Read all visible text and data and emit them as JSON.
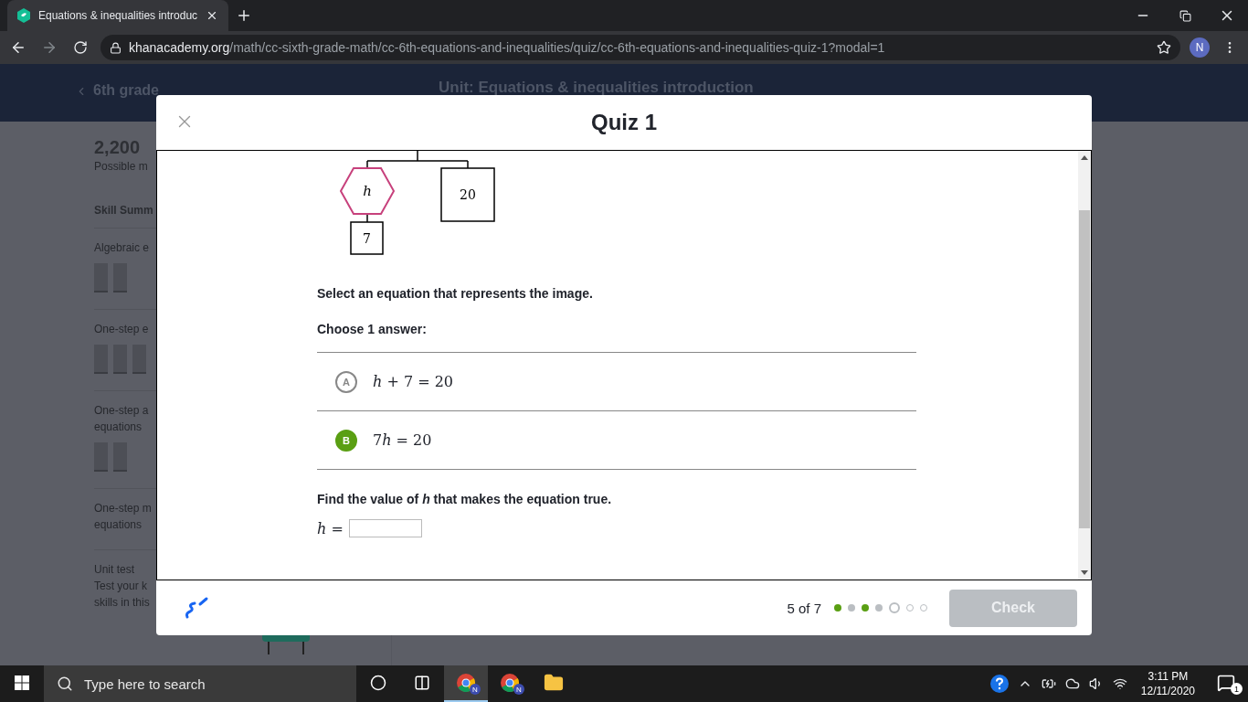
{
  "browser": {
    "tab": {
      "title": "Equations & inequalities introduc"
    },
    "url": {
      "domain": "khanacademy.org",
      "path": "/math/cc-sixth-grade-math/cc-6th-equations-and-inequalities/quiz/cc-6th-equations-and-inequalities-quiz-1?modal=1"
    },
    "profile_initial": "N"
  },
  "background_page": {
    "back_link": "6th grade",
    "unit_title": "Unit: Equations & inequalities introduction",
    "points": "2,200",
    "points_label": "Possible m",
    "section_title": "Skill Summ",
    "skills": [
      {
        "lines": [
          "Algebraic e"
        ],
        "bars": [
          {
            "mastered": false
          },
          {
            "mastered": false
          }
        ]
      },
      {
        "lines": [
          "One-step e"
        ],
        "bars": [
          {
            "mastered": false
          },
          {
            "mastered": false
          },
          {
            "mastered": false
          }
        ]
      },
      {
        "lines": [
          "One-step a",
          "equations"
        ],
        "bars": [
          {
            "mastered": false
          },
          {
            "mastered": false
          }
        ]
      },
      {
        "lines": [
          "One-step m",
          "equations"
        ]
      }
    ],
    "unit_test": {
      "title": "Unit test",
      "lines": [
        "Test your k",
        "skills in this"
      ]
    }
  },
  "modal": {
    "title": "Quiz 1",
    "diagram": {
      "top_node": "h",
      "side_node": "20",
      "bottom_node": "7"
    },
    "prompt": "Select an equation that represents the image.",
    "choose_label": "Choose 1 answer:",
    "choices": [
      {
        "letter": "A",
        "math": "h + 7 = 20",
        "selected": false
      },
      {
        "letter": "B",
        "math": "7h = 20",
        "selected": true
      }
    ],
    "find_prompt": "Find the value of *h* that makes the equation true.",
    "answer_label": "h =",
    "footer": {
      "progress": "5 of 7",
      "dots": [
        {
          "kind": "correct"
        },
        {
          "kind": "incorrect"
        },
        {
          "kind": "correct"
        },
        {
          "kind": "incorrect"
        },
        {
          "kind": "current"
        },
        {
          "kind": "upcoming"
        },
        {
          "kind": "upcoming"
        }
      ],
      "check_button": {
        "label": "Check",
        "disabled": true
      }
    }
  },
  "taskbar": {
    "search_placeholder": "Type here to search",
    "apps": [
      {
        "kind": "chrome",
        "active": true,
        "badge": "N"
      },
      {
        "kind": "chrome",
        "active": false,
        "badge": "N"
      },
      {
        "kind": "explorer",
        "active": false
      }
    ],
    "time": "3:11 PM",
    "date": "12/11/2020",
    "notifications": "1"
  }
}
